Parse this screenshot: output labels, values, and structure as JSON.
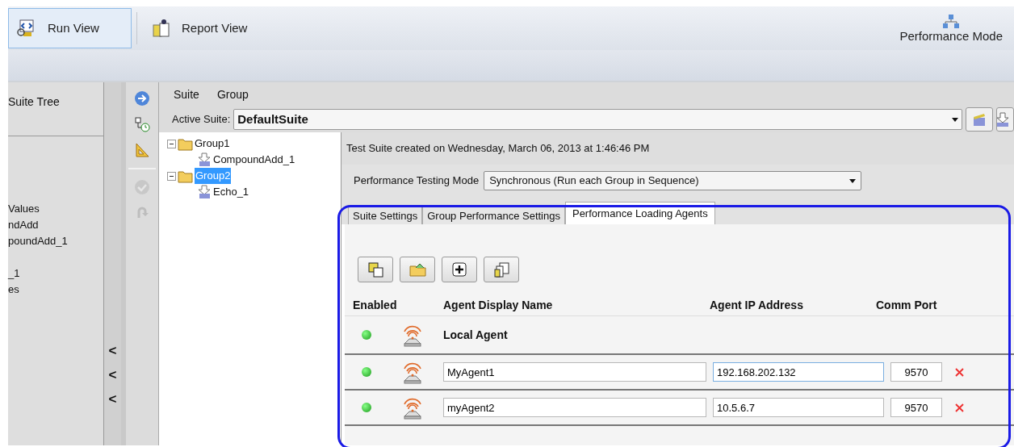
{
  "toolbar": {
    "buttons": [
      {
        "label": "Run View",
        "selected": true
      },
      {
        "label": "Report View",
        "selected": false
      }
    ],
    "mode": "Performance Mode"
  },
  "suite_tree": {
    "title": "Suite Tree",
    "items": [
      "Values",
      "ndAdd",
      "poundAdd_1",
      "_1",
      "es"
    ]
  },
  "splitter": {
    "arrows": [
      "<",
      "<",
      "<"
    ]
  },
  "side_tools": [
    {
      "kind": "go",
      "disabled": false
    },
    {
      "kind": "schedule",
      "disabled": false
    },
    {
      "kind": "measure",
      "disabled": false
    },
    {
      "kind": "check",
      "disabled": true
    },
    {
      "kind": "undo",
      "disabled": true
    }
  ],
  "menu": [
    "Suite",
    "Group"
  ],
  "active_suite": {
    "label": "Active Suite:",
    "value": "DefaultSuite"
  },
  "tree": [
    {
      "label": "Group1",
      "selected": false,
      "expanded": true,
      "children": [
        {
          "label": "CompoundAdd_1",
          "selected": false
        }
      ]
    },
    {
      "label": "Group2",
      "selected": true,
      "expanded": true,
      "children": [
        {
          "label": "Echo_1",
          "selected": false
        }
      ]
    }
  ],
  "info": "Test Suite created on Wednesday, March 06, 2013 at 1:46:46 PM",
  "mode_field": {
    "label": "Performance Testing Mode",
    "value": "Synchronous (Run each Group in Sequence)"
  },
  "tabs": [
    {
      "label": "Suite Settings",
      "selected": false
    },
    {
      "label": "Group Performance Settings",
      "selected": false
    },
    {
      "label": "Performance Loading Agents",
      "selected": true
    }
  ],
  "agent_tools": [
    {
      "kind": "save"
    },
    {
      "kind": "open"
    },
    {
      "kind": "add"
    },
    {
      "kind": "copy"
    }
  ],
  "agents": {
    "columns": [
      "Enabled",
      "Agent Display Name",
      "Agent IP Address",
      "Comm Port"
    ],
    "rows": [
      {
        "kind": "local",
        "enabled": true,
        "name": "Local Agent"
      },
      {
        "kind": "remote",
        "enabled": true,
        "name": "MyAgent1",
        "ip": "192.168.202.132",
        "port": "9570"
      },
      {
        "kind": "remote",
        "enabled": true,
        "name": "myAgent2",
        "ip": "10.5.6.7",
        "port": "9570"
      }
    ]
  }
}
